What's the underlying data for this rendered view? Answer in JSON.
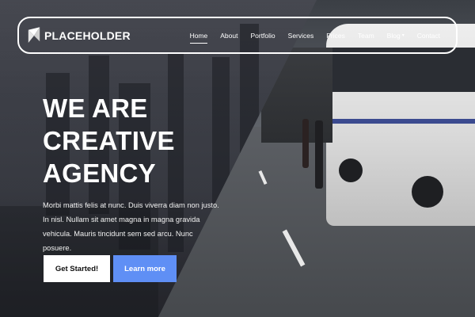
{
  "brand": {
    "name": "PLACEHOLDER",
    "logo_icon": "placeholder-logo-icon"
  },
  "nav": {
    "items": [
      {
        "label": "Home",
        "active": true
      },
      {
        "label": "About",
        "active": false
      },
      {
        "label": "Portfolio",
        "active": false
      },
      {
        "label": "Services",
        "active": false
      },
      {
        "label": "Prices",
        "active": false
      },
      {
        "label": "Team",
        "active": false
      },
      {
        "label": "Blog",
        "active": false,
        "dropdown": true
      },
      {
        "label": "Contact",
        "active": false
      }
    ],
    "dropdown_icon": "chevron-down-icon"
  },
  "hero": {
    "headline_line1": "WE ARE",
    "headline_line2": "CREATIVE",
    "headline_line3": "AGENCY",
    "subtext": "Morbi mattis felis at nunc. Duis viverra diam non justo. In nisl. Nullam sit amet magna in magna gravida vehicula. Mauris tincidunt sem sed arcu. Nunc posuere.",
    "primary_button": "Get Started!",
    "secondary_button": "Learn more"
  },
  "colors": {
    "accent": "#5f8ff5",
    "text": "#ffffff",
    "primary_button_bg": "#ffffff"
  }
}
